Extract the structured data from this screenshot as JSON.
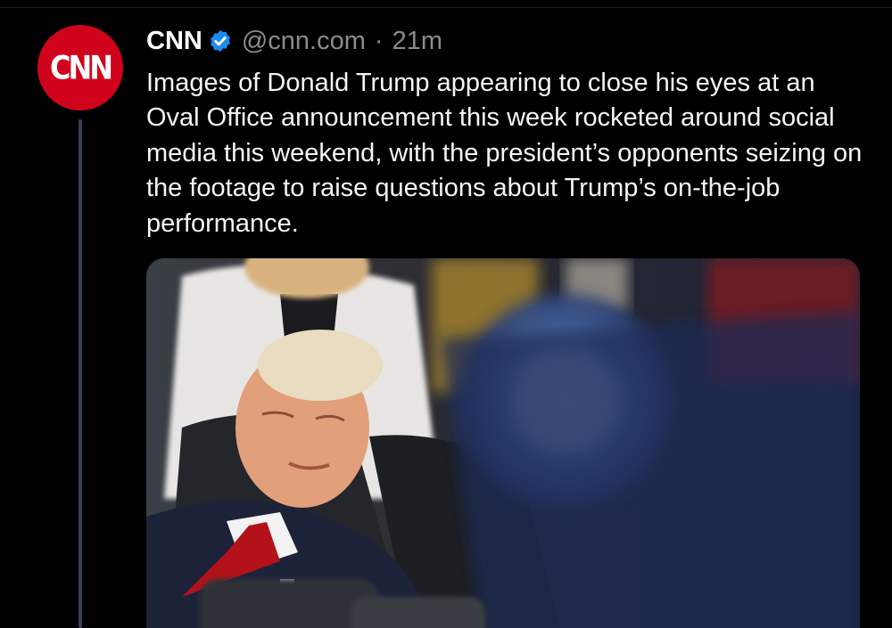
{
  "post": {
    "author": {
      "display_name": "CNN",
      "handle": "@cnn.com",
      "avatar_text": "CNN",
      "avatar_color": "#d0021b",
      "verified": true,
      "verified_icon": "verified-check-icon",
      "verified_color": "#1d8bf0"
    },
    "separator": "·",
    "timestamp": "21m",
    "text": "Images of Donald Trump appearing to close his eyes at an Oval Office announcement this week rocketed around social media this weekend, with the president’s opponents seizing on the footage to raise questions about Trump’s on-the-job performance."
  },
  "colors": {
    "background": "#000000",
    "thread_line": "#3a3f55",
    "muted_text": "#8b8b8f"
  }
}
